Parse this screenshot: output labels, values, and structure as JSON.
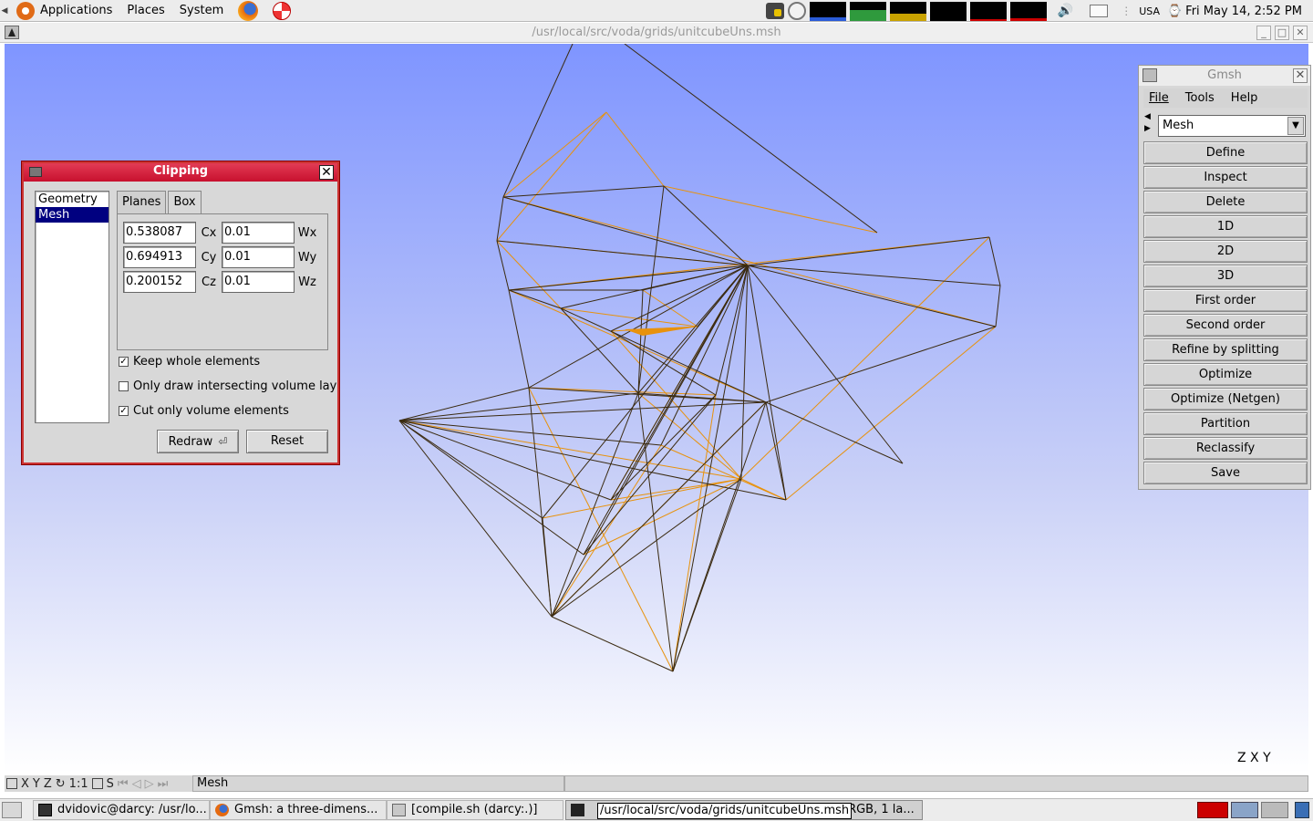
{
  "top_panel": {
    "menus": [
      "Applications",
      "Places",
      "System"
    ],
    "keyboard": "USA",
    "datetime": "Fri May 14,  2:52 PM"
  },
  "main_window": {
    "title": "/usr/local/src/voda/grids/unitcubeUns.msh",
    "axes": "Z X Y"
  },
  "status_bar": {
    "items": [
      "X",
      "Y",
      "Z",
      "1:1",
      "S"
    ],
    "message": "Mesh"
  },
  "clipping": {
    "title": "Clipping",
    "list": [
      "Geometry",
      "Mesh"
    ],
    "selected": "Mesh",
    "tabs": [
      "Planes",
      "Box"
    ],
    "active_tab": "Box",
    "fields": [
      {
        "c_value": "0.538087",
        "c_label": "Cx",
        "w_value": "0.01",
        "w_label": "Wx"
      },
      {
        "c_value": "0.694913",
        "c_label": "Cy",
        "w_value": "0.01",
        "w_label": "Wy"
      },
      {
        "c_value": "0.200152",
        "c_label": "Cz",
        "w_value": "0.01",
        "w_label": "Wz"
      }
    ],
    "checks": [
      {
        "label": "Keep whole elements",
        "checked": true
      },
      {
        "label": "Only draw intersecting volume lay",
        "checked": false
      },
      {
        "label": "Cut only volume elements",
        "checked": true
      }
    ],
    "redraw": "Redraw",
    "reset": "Reset"
  },
  "gmsh_menu": {
    "title": "Gmsh",
    "menubar": [
      "File",
      "Tools",
      "Help"
    ],
    "module": "Mesh",
    "buttons": [
      "Define",
      "Inspect",
      "Delete",
      "1D",
      "2D",
      "3D",
      "First order",
      "Second order",
      "Refine by splitting",
      "Optimize",
      "Optimize (Netgen)",
      "Partition",
      "Reclassify",
      "Save"
    ]
  },
  "taskbar": {
    "items": [
      {
        "label": "dvidovic@darcy: /usr/lo..."
      },
      {
        "label": "Gmsh: a three-dimens..."
      },
      {
        "label": "[compile.sh (darcy:.)]"
      },
      {
        "label": "(RGB, 1 la..."
      }
    ],
    "tooltip": "/usr/local/src/voda/grids/unitcubeUns.msh"
  },
  "colors": {
    "clipping_title": "#c8102e",
    "selection": "#000080",
    "mesh_dark": "#3a2a10",
    "mesh_orange": "#e8920c"
  }
}
